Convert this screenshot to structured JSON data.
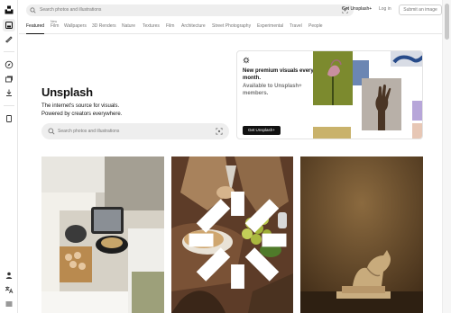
{
  "header": {
    "search_placeholder": "Search photos and illustrations",
    "get_plus": "Get Unsplash+",
    "login": "Log in",
    "submit": "Submit an image"
  },
  "tabs": {
    "items": [
      {
        "label": "Featured",
        "active": true
      },
      {
        "label": "Film",
        "superscript": "New"
      },
      {
        "label": "Wallpapers"
      },
      {
        "label": "3D Renders"
      },
      {
        "label": "Nature"
      },
      {
        "label": "Textures"
      },
      {
        "label": "Film"
      },
      {
        "label": "Architecture"
      },
      {
        "label": "Street Photography"
      },
      {
        "label": "Experimental"
      },
      {
        "label": "Travel"
      },
      {
        "label": "People"
      }
    ]
  },
  "hero": {
    "title": "Unsplash",
    "subtitle": "The internet's source for visuals. Powered by creators everywhere.",
    "search_placeholder": "Search photos and illustrations"
  },
  "promo": {
    "title": "New premium visuals every month.",
    "subtitle": "Available to Unsplash+ members.",
    "button": "Get Unsplash+"
  },
  "rail": {
    "icons": [
      "unsplash-logo-icon",
      "home-icon",
      "illustration-icon",
      "explore-icon",
      "collections-icon",
      "download-icon",
      "bookmark-icon",
      "user-icon",
      "language-icon",
      "menu-icon"
    ]
  },
  "photos": [
    {
      "description_icon": "kitchen-photo"
    },
    {
      "description_icon": "market-produce-photo",
      "plus": true
    },
    {
      "description_icon": "sculpture-photo"
    }
  ],
  "colors": {
    "accent": "#111111",
    "muted": "#767676",
    "search_bg": "#eeeeee"
  }
}
